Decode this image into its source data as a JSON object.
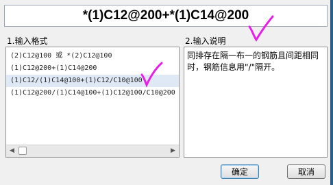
{
  "formula_input": {
    "value": "*(1)C12@200+*(1)C14@200"
  },
  "left_section": {
    "label": "1.输入格式",
    "items": [
      "(2)C12@100 或 *(2)C12@100",
      "(1)C12@200+(1)C14@200",
      "(1)C12/(1)C14@100+(1)C12/C10@100",
      "(1)C12@200/(1)C14@100+(1)C12@100/C10@200"
    ],
    "selected_index": 2
  },
  "right_section": {
    "label": "2.输入说明",
    "description": "同排存在隔一布一的钢筋且间距相同时，钢筋信息用\"/\"隔开。"
  },
  "buttons": {
    "ok": "确定",
    "cancel": "取消"
  },
  "colors": {
    "annotation": "#e81ee8",
    "selection": "#dfe9f5"
  },
  "icons": {
    "scroll_left": "left-arrow-icon",
    "scroll_right": "right-arrow-icon"
  }
}
